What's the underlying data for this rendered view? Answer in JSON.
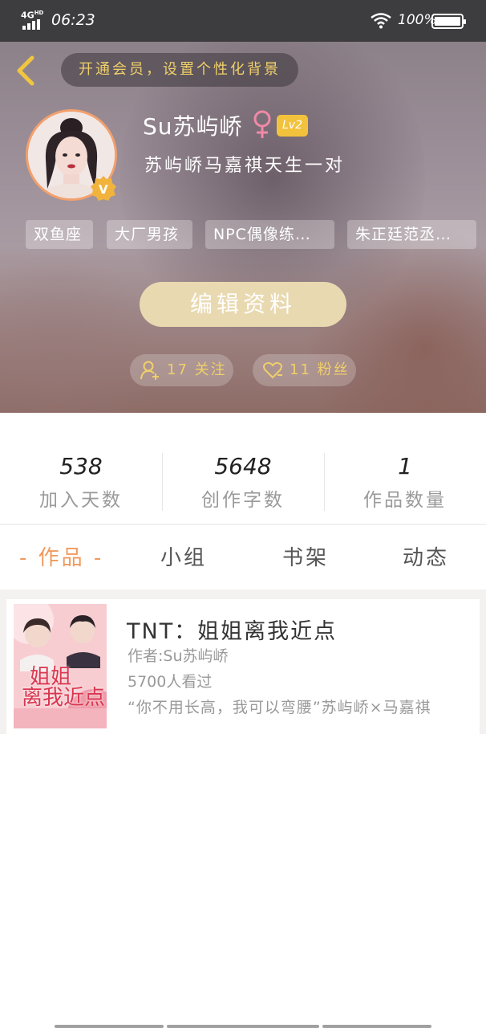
{
  "status_bar": {
    "network": "4G",
    "network_sup": "HD",
    "time": "06:23",
    "battery": "100%"
  },
  "header": {
    "vip_banner": "开通会员，设置个性化背景",
    "username": "Su苏屿峤",
    "gender": "♀",
    "level": "Lv2",
    "signature": "苏屿峤马嘉祺天生一对",
    "tags": [
      "双鱼座",
      "大厂男孩",
      "NPC偶像练…",
      "朱正廷范丞…"
    ],
    "edit_button": "编辑资料",
    "follow": "17 关注",
    "fans": "11 粉丝"
  },
  "stats": [
    {
      "value": "538",
      "label": "加入天数"
    },
    {
      "value": "5648",
      "label": "创作字数"
    },
    {
      "value": "1",
      "label": "作品数量"
    }
  ],
  "tabs": [
    {
      "label": "- 作品 -",
      "active": true
    },
    {
      "label": "小组",
      "active": false
    },
    {
      "label": "书架",
      "active": false
    },
    {
      "label": "动态",
      "active": false
    }
  ],
  "book": {
    "title": "TNT：姐姐离我近点",
    "author": "作者:Su苏屿峤",
    "views": "5700人看过",
    "description": "“你不用长高，我可以弯腰”苏屿峤×马嘉祺",
    "cover_text_1": "姐姐",
    "cover_text_2": "离我近点"
  }
}
